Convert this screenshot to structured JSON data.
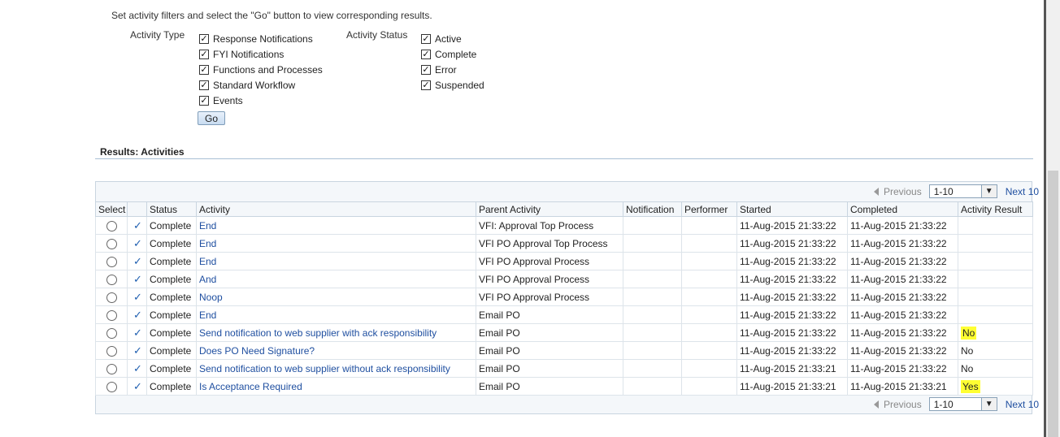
{
  "instructions": "Set activity filters and select the \"Go\" button to view corresponding results.",
  "filters": {
    "activity_type_label": "Activity Type",
    "activity_types": [
      {
        "label": "Response Notifications",
        "checked": true
      },
      {
        "label": "FYI Notifications",
        "checked": true
      },
      {
        "label": "Functions and Processes",
        "checked": true
      },
      {
        "label": "Standard Workflow",
        "checked": true
      },
      {
        "label": "Events",
        "checked": true
      }
    ],
    "activity_status_label": "Activity Status",
    "activity_statuses": [
      {
        "label": "Active",
        "checked": true
      },
      {
        "label": "Complete",
        "checked": true
      },
      {
        "label": "Error",
        "checked": true
      },
      {
        "label": "Suspended",
        "checked": true
      }
    ],
    "go_label": "Go"
  },
  "results": {
    "header": "Results: Activities",
    "pager": {
      "previous": "Previous",
      "range": "1-10",
      "next": "Next 10"
    },
    "columns": [
      "Select",
      "",
      "Status",
      "Activity",
      "Parent Activity",
      "Notification",
      "Performer",
      "Started",
      "Completed",
      "Activity Result"
    ],
    "rows": [
      {
        "status": "Complete",
        "activity": "End",
        "parent": "VFI: Approval Top Process",
        "notification": "",
        "performer": "",
        "started": "11-Aug-2015 21:33:22",
        "completed": "11-Aug-2015 21:33:22",
        "result": "",
        "highlight": false
      },
      {
        "status": "Complete",
        "activity": "End",
        "parent": "VFI PO Approval Top Process",
        "notification": "",
        "performer": "",
        "started": "11-Aug-2015 21:33:22",
        "completed": "11-Aug-2015 21:33:22",
        "result": "",
        "highlight": false
      },
      {
        "status": "Complete",
        "activity": "End",
        "parent": "VFI PO Approval Process",
        "notification": "",
        "performer": "",
        "started": "11-Aug-2015 21:33:22",
        "completed": "11-Aug-2015 21:33:22",
        "result": "",
        "highlight": false
      },
      {
        "status": "Complete",
        "activity": "And",
        "parent": "VFI PO Approval Process",
        "notification": "",
        "performer": "",
        "started": "11-Aug-2015 21:33:22",
        "completed": "11-Aug-2015 21:33:22",
        "result": "",
        "highlight": false
      },
      {
        "status": "Complete",
        "activity": "Noop",
        "parent": "VFI PO Approval Process",
        "notification": "",
        "performer": "",
        "started": "11-Aug-2015 21:33:22",
        "completed": "11-Aug-2015 21:33:22",
        "result": "",
        "highlight": false
      },
      {
        "status": "Complete",
        "activity": "End",
        "parent": "Email PO",
        "notification": "",
        "performer": "",
        "started": "11-Aug-2015 21:33:22",
        "completed": "11-Aug-2015 21:33:22",
        "result": "",
        "highlight": false
      },
      {
        "status": "Complete",
        "activity": "Send notification to web supplier with ack responsibility",
        "parent": "Email PO",
        "notification": "",
        "performer": "",
        "started": "11-Aug-2015 21:33:22",
        "completed": "11-Aug-2015 21:33:22",
        "result": "No",
        "highlight": true
      },
      {
        "status": "Complete",
        "activity": "Does PO Need Signature?",
        "parent": "Email PO",
        "notification": "",
        "performer": "",
        "started": "11-Aug-2015 21:33:22",
        "completed": "11-Aug-2015 21:33:22",
        "result": "No",
        "highlight": false
      },
      {
        "status": "Complete",
        "activity": "Send notification to web supplier without ack responsibility",
        "parent": "Email PO",
        "notification": "",
        "performer": "",
        "started": "11-Aug-2015 21:33:21",
        "completed": "11-Aug-2015 21:33:22",
        "result": "No",
        "highlight": false
      },
      {
        "status": "Complete",
        "activity": "Is Acceptance Required",
        "parent": "Email PO",
        "notification": "",
        "performer": "",
        "started": "11-Aug-2015 21:33:21",
        "completed": "11-Aug-2015 21:33:21",
        "result": "Yes",
        "highlight": true
      }
    ]
  }
}
